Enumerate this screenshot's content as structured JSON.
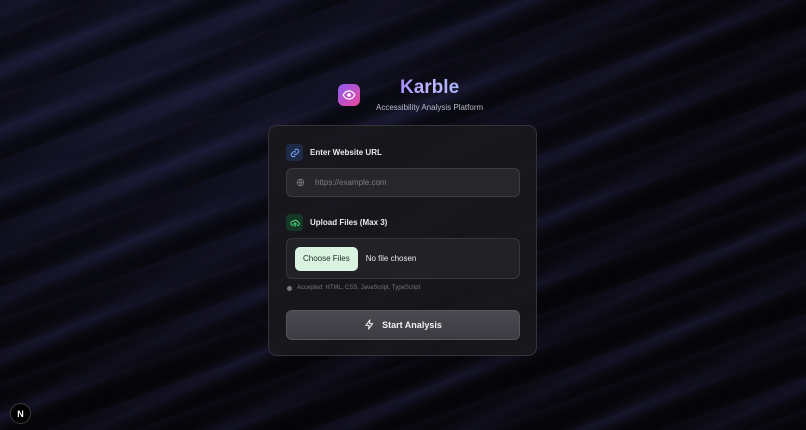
{
  "brand": {
    "title": "Karble",
    "subtitle": "Accessibility Analysis Platform"
  },
  "url_section": {
    "label": "Enter Website URL",
    "placeholder": "https://example.com",
    "value": ""
  },
  "upload_section": {
    "label": "Upload Files (Max 3)",
    "choose_label": "Choose Files",
    "status": "No file chosen",
    "hint": "Accepted: HTML, CSS, JavaScript, TypeScript"
  },
  "actions": {
    "start_label": "Start Analysis"
  },
  "corner_badge": {
    "letter": "N"
  },
  "colors": {
    "accent_purple": "#8b5cf6",
    "url_icon_bg": "#1e2a44",
    "upload_icon_bg": "#163626",
    "choose_button_bg": "#d9f3e0"
  }
}
